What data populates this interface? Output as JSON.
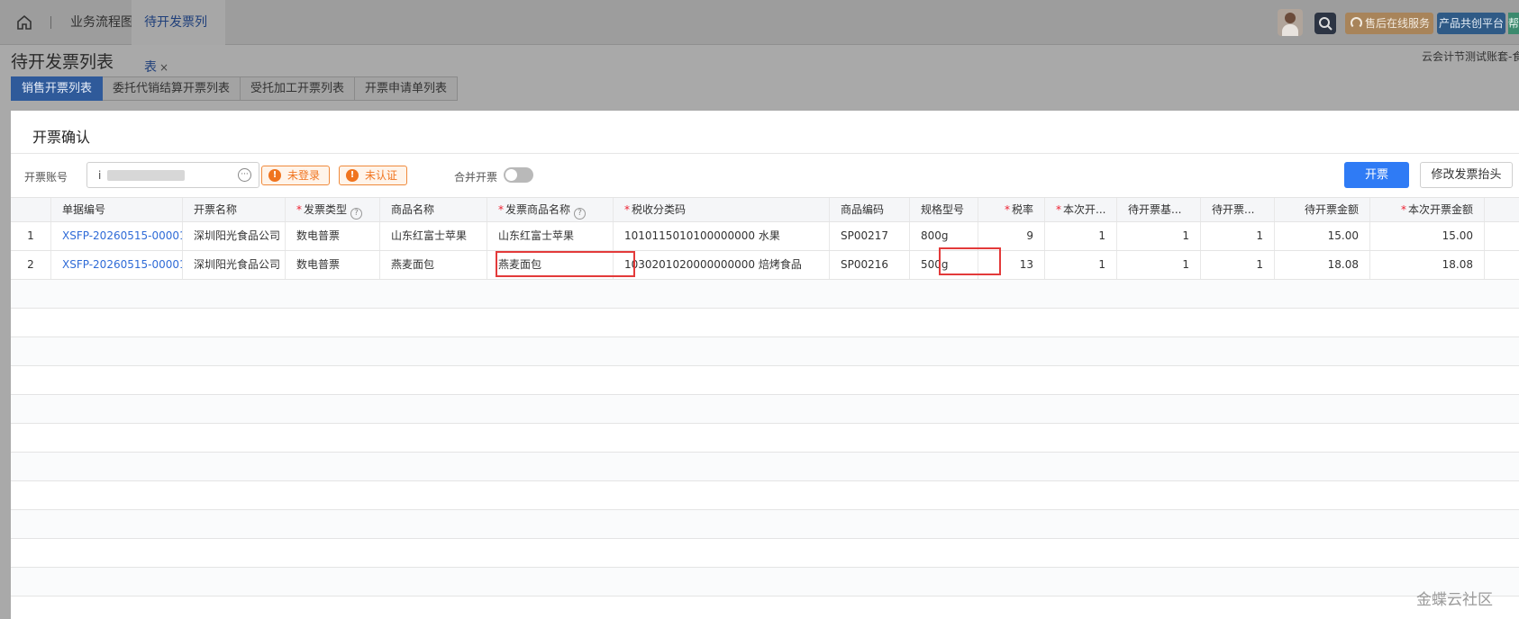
{
  "topbar": {
    "tabs": [
      {
        "label": "业务流程图"
      },
      {
        "label": "待开发票列表",
        "close": "×"
      }
    ],
    "service_label": "售后在线服务",
    "platform_label": "产品共创平台",
    "help_label": "帮"
  },
  "page": {
    "title": "待开发票列表",
    "account": "云会计节测试账套-食",
    "subtabs": [
      "销售开票列表",
      "委托代销结算开票列表",
      "受托加工开票列表",
      "开票申请单列表"
    ]
  },
  "dialog": {
    "title": "开票确认",
    "account_label": "开票账号",
    "account_value": "i",
    "more_glyph": "···",
    "tag_not_logged": "未登录",
    "tag_not_certified": "未认证",
    "merge_label": "合并开票",
    "merge_enabled": false,
    "issue_button": "开票",
    "edit_header_button": "修改发票抬头"
  },
  "table": {
    "columns": [
      {
        "label": "单据编号",
        "required": false
      },
      {
        "label": "开票名称",
        "required": false
      },
      {
        "label": "发票类型",
        "required": true,
        "help": true
      },
      {
        "label": "商品名称",
        "required": false
      },
      {
        "label": "发票商品名称",
        "required": true,
        "help": true
      },
      {
        "label": "税收分类码",
        "required": true
      },
      {
        "label": "商品编码",
        "required": false
      },
      {
        "label": "规格型号",
        "required": false
      },
      {
        "label": "税率",
        "required": true
      },
      {
        "label": "本次开...",
        "required": true
      },
      {
        "label": "待开票基...",
        "required": false
      },
      {
        "label": "待开票...",
        "required": false
      },
      {
        "label": "待开票金额",
        "required": false
      },
      {
        "label": "本次开票金额",
        "required": true
      }
    ],
    "rows": [
      {
        "index": "1",
        "doc_no": "XSFP-20260515-00001",
        "name": "深圳阳光食品公司",
        "inv_type": "数电普票",
        "product": "山东红富士苹果",
        "inv_product": "山东红富士苹果",
        "tax_code": "1010115010100000000 水果",
        "code": "SP00217",
        "spec": "800g",
        "rate": "9",
        "qty": "1",
        "base": "1",
        "pending": "1",
        "pending_amount": "15.00",
        "amount": "15.00"
      },
      {
        "index": "2",
        "doc_no": "XSFP-20260515-00001",
        "name": "深圳阳光食品公司",
        "inv_type": "数电普票",
        "product": "燕麦面包",
        "inv_product": "燕麦面包",
        "tax_code": "1030201020000000000 焙烤食品",
        "code": "SP00216",
        "spec": "500g",
        "rate": "13",
        "qty": "1",
        "base": "1",
        "pending": "1",
        "pending_amount": "18.08",
        "amount": "18.08"
      }
    ]
  },
  "watermark": "金蝶云社区",
  "colors": {
    "primary": "#2f7bf5",
    "warn": "#f0741f",
    "link": "#2f6bd7",
    "highlight": "#e33a3a"
  }
}
